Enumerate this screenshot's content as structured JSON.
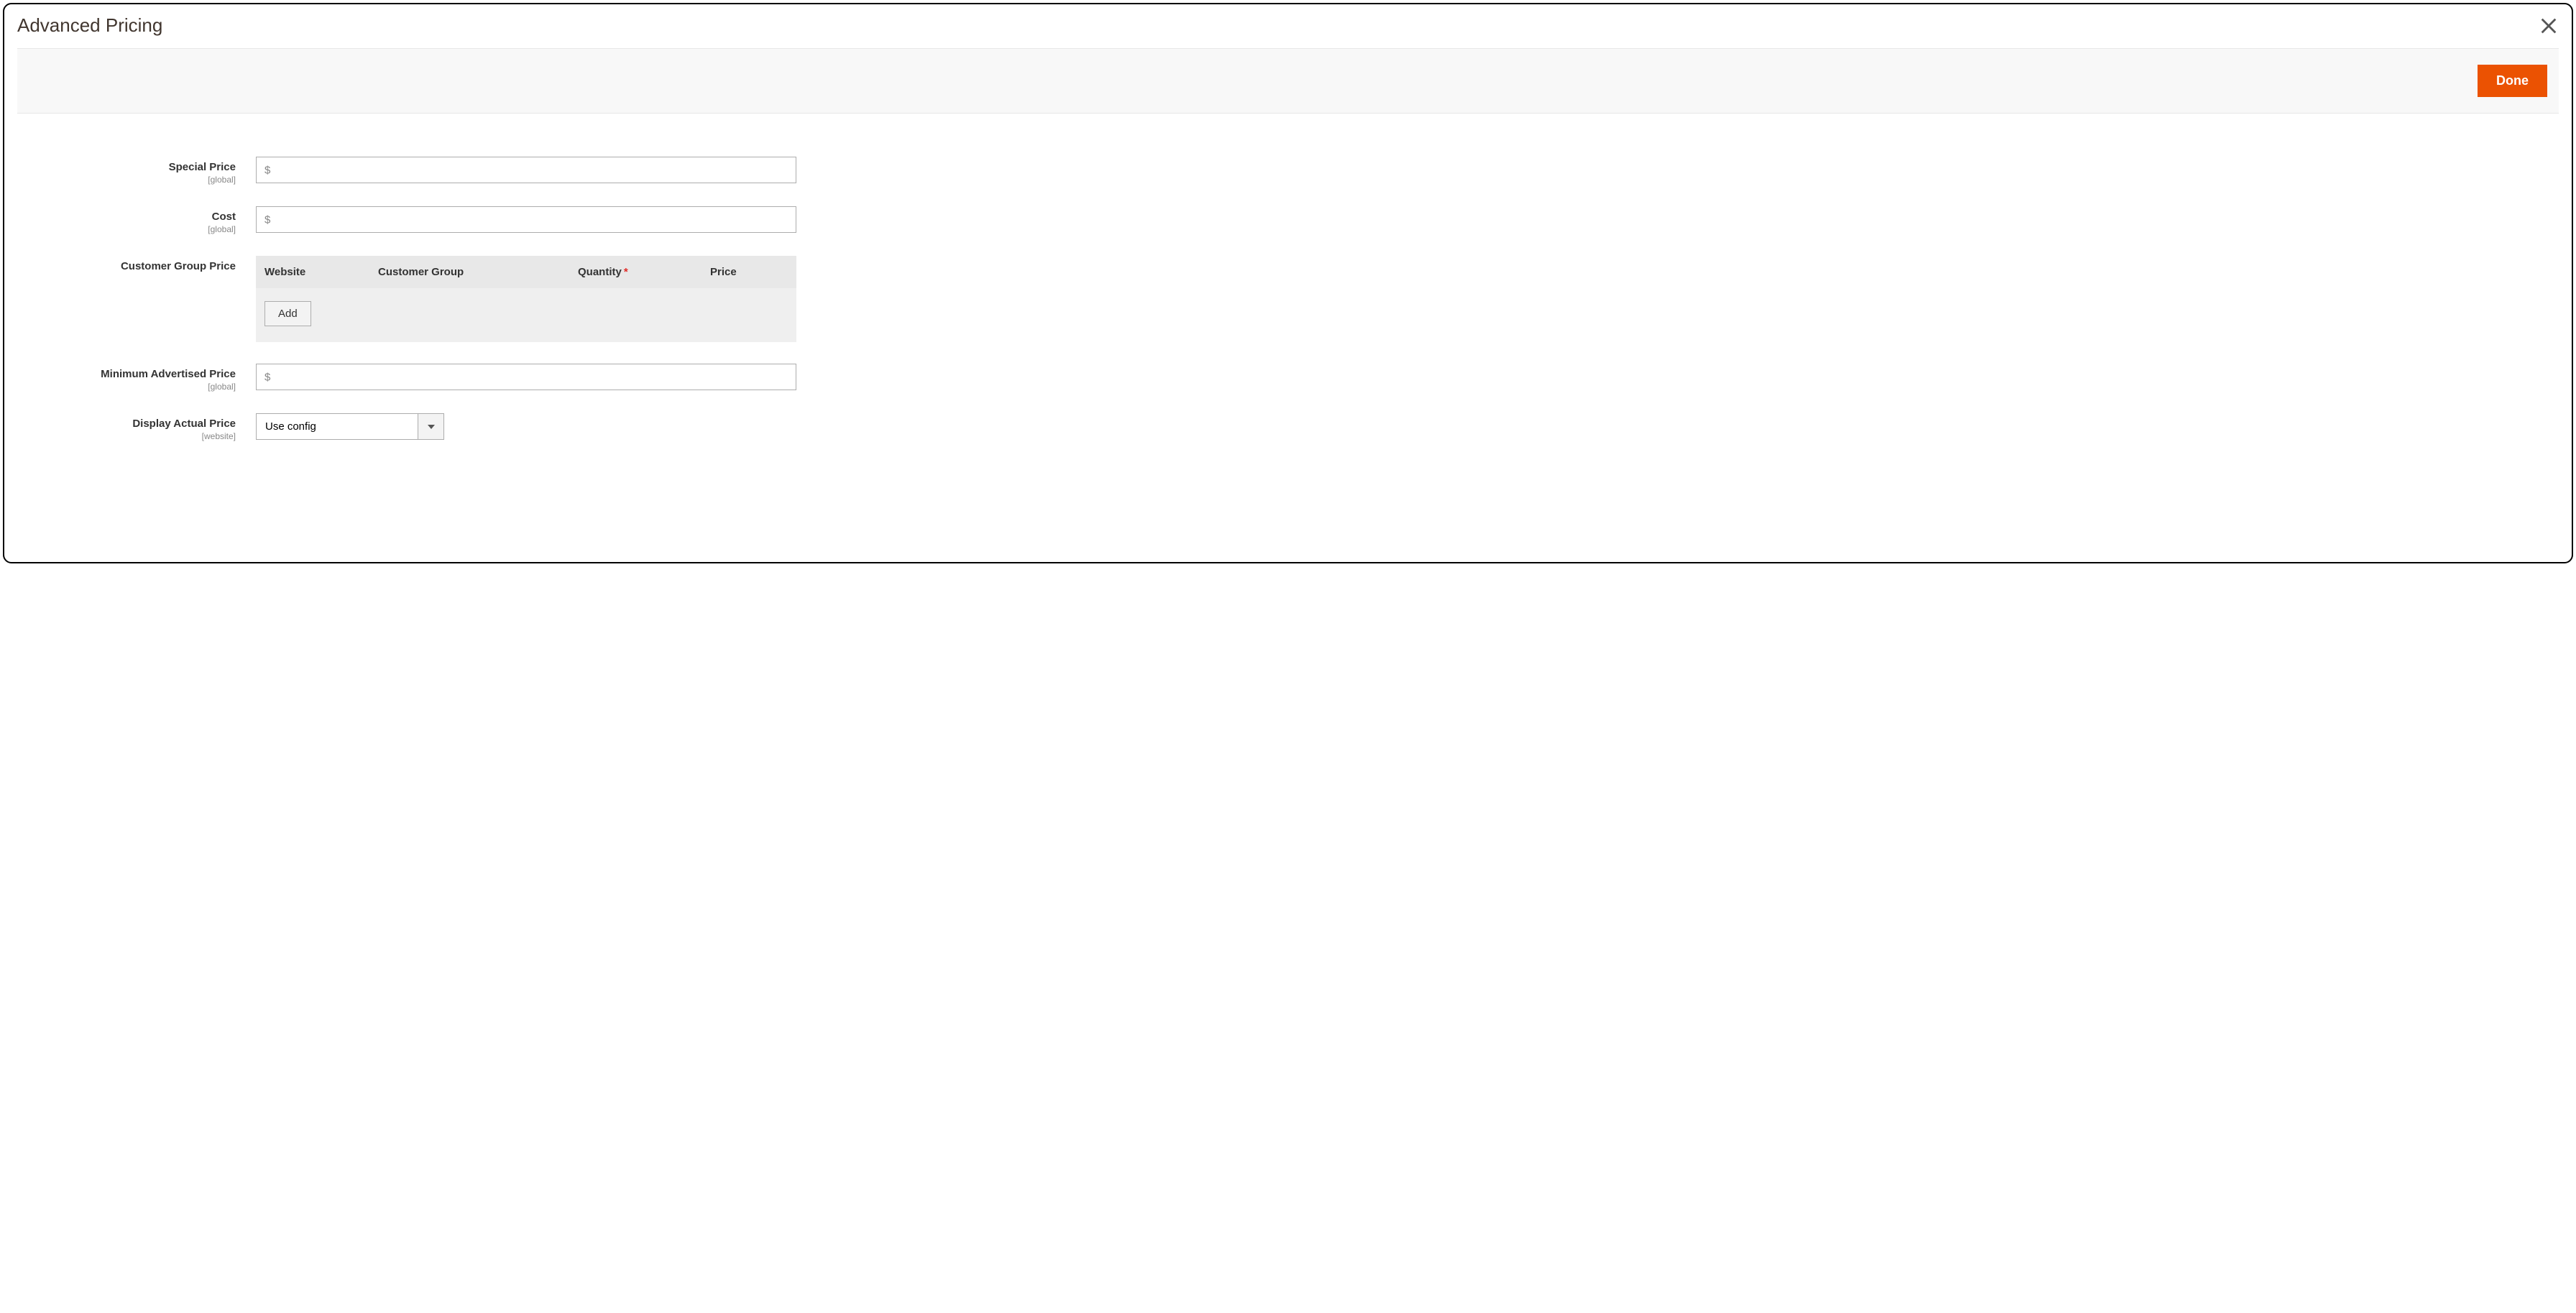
{
  "modal": {
    "title": "Advanced Pricing"
  },
  "toolbar": {
    "done_label": "Done"
  },
  "fields": {
    "special_price": {
      "label": "Special Price",
      "scope": "[global]",
      "currency": "$",
      "value": ""
    },
    "cost": {
      "label": "Cost",
      "scope": "[global]",
      "currency": "$",
      "value": ""
    },
    "customer_group_price": {
      "label": "Customer Group Price",
      "columns": {
        "website": "Website",
        "customer_group": "Customer Group",
        "quantity": "Quantity",
        "price": "Price"
      },
      "add_button": "Add"
    },
    "map": {
      "label": "Minimum Advertised Price",
      "scope": "[global]",
      "currency": "$",
      "value": ""
    },
    "display_actual_price": {
      "label": "Display Actual Price",
      "scope": "[website]",
      "value": "Use config"
    }
  }
}
